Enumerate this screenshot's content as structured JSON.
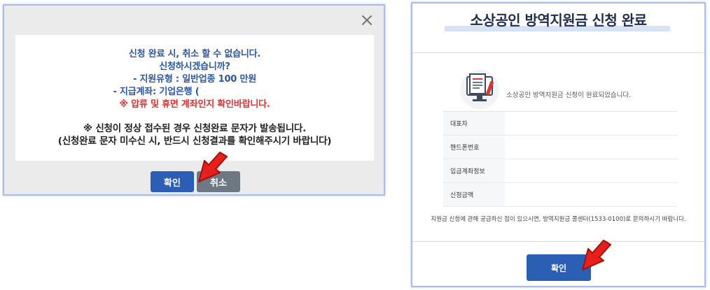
{
  "dialog": {
    "close_glyph": "×",
    "lines": [
      "신청 완료 시, 취소 할 수 없습니다.",
      "신청하시겠습니까?",
      "- 지원유형 : 일반업종 100 만원",
      "- 지급계좌: 기업은행 (",
      "※ 압류 및 휴면 계좌인지 확인바랍니다.",
      "※ 신청이 정상 접수된 경우 신청완료 문자가 발송됩니다.",
      "(신청완료 문자 미수신 시, 반드시 신청결과를 확인해주시기 바랍니다)"
    ],
    "ok_label": "확인",
    "cancel_label": "취소"
  },
  "panel": {
    "title": "소상공인 방역지원금 신청 완료",
    "done_message": "소상공인 방역지원금 신청이 완료되었습니다.",
    "rows": [
      {
        "label": "대표자",
        "value": ""
      },
      {
        "label": "핸드폰번호",
        "value": ""
      },
      {
        "label": "입금계좌정보",
        "value": ""
      },
      {
        "label": "신청금액",
        "value": ""
      }
    ],
    "notice": "지원금 신청에 관해 궁금하신 점이 있으시면, 방역지원금 콜센터(1533-0100)로 문의하시기 바랍니다.",
    "ok_label": "확인"
  },
  "colors": {
    "primary_button": "#2b5fb6",
    "cancel_button": "#6d7882",
    "text_blue": "#2a56a8",
    "text_red": "#e0322f",
    "arrow_red": "#e8201b",
    "frame_border": "#a9bde8"
  },
  "icons": {
    "dialog_close": "close-icon",
    "pointer": "red-arrow-icon",
    "document": "document-monitor-icon"
  }
}
